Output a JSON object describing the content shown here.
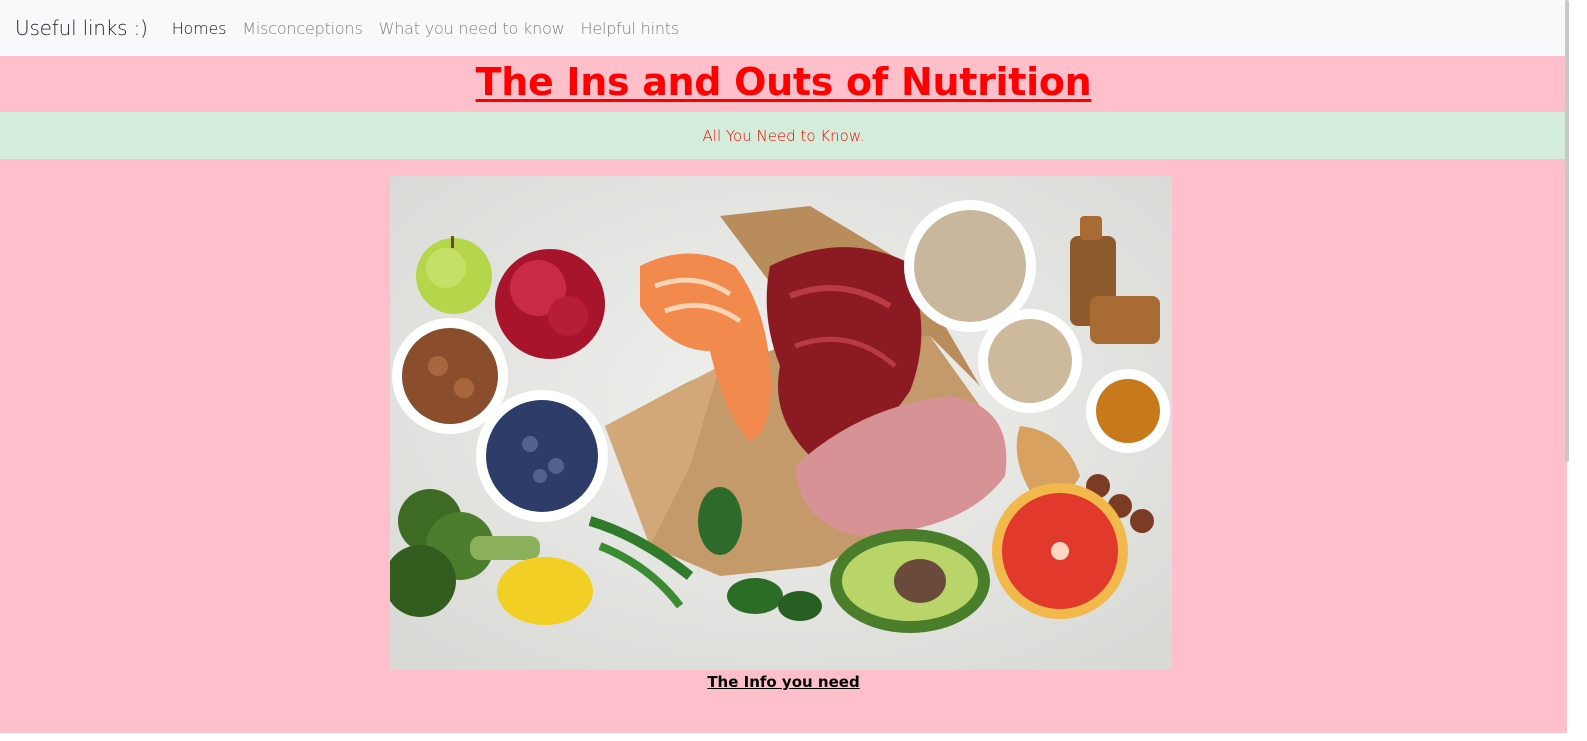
{
  "navbar": {
    "brand": "Useful links :)",
    "links": [
      {
        "label": "Homes",
        "active": true
      },
      {
        "label": "Misconceptions",
        "active": false
      },
      {
        "label": "What you need to know",
        "active": false
      },
      {
        "label": "Helpful hints",
        "active": false
      }
    ]
  },
  "header": {
    "title": "The Ins and Outs of Nutrition",
    "subtitle": "All You Need to Know."
  },
  "hero": {
    "caption": "The Info you need"
  },
  "colors": {
    "page_background": "#ffc0cb",
    "subtitle_band": "#d4edda",
    "title_text": "#ff0000",
    "navbar_background": "#f8f9fa"
  }
}
